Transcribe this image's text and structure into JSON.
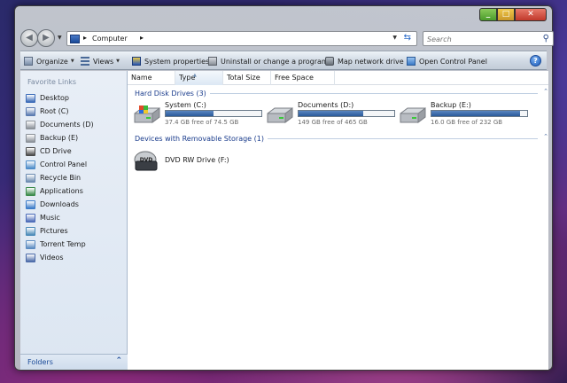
{
  "navigation": {
    "address_segments": [
      "Computer"
    ],
    "search_placeholder": "Search"
  },
  "toolbar": {
    "items": [
      {
        "label": "Organize",
        "dropdown": true
      },
      {
        "label": "Views",
        "dropdown": true
      },
      {
        "label": "System properties",
        "dropdown": false
      },
      {
        "label": "Uninstall or change a program",
        "dropdown": false
      },
      {
        "label": "Map network drive",
        "dropdown": false
      },
      {
        "label": "Open Control Panel",
        "dropdown": false
      }
    ]
  },
  "sidebar": {
    "title": "Favorite Links",
    "items": [
      {
        "label": "Desktop",
        "icon": "desktop-icon",
        "color": "#3a6ab8"
      },
      {
        "label": "Root (C)",
        "icon": "drive-icon",
        "color": "#5a7ab0"
      },
      {
        "label": "Documents (D)",
        "icon": "drive-icon",
        "color": "#8a9098"
      },
      {
        "label": "Backup (E)",
        "icon": "drive-icon",
        "color": "#8a9098"
      },
      {
        "label": "CD Drive",
        "icon": "disc-icon",
        "color": "#4a4a4a"
      },
      {
        "label": "Control Panel",
        "icon": "control-panel-icon",
        "color": "#4a8ac8"
      },
      {
        "label": "Recycle Bin",
        "icon": "recycle-bin-icon",
        "color": "#6a8ab0"
      },
      {
        "label": "Applications",
        "icon": "applications-icon",
        "color": "#3a8a4a"
      },
      {
        "label": "Downloads",
        "icon": "downloads-icon",
        "color": "#3a7ac8"
      },
      {
        "label": "Music",
        "icon": "music-icon",
        "color": "#4a6ab8"
      },
      {
        "label": "Pictures",
        "icon": "pictures-icon",
        "color": "#4a8ab8"
      },
      {
        "label": "Torrent Temp",
        "icon": "folder-icon",
        "color": "#5a8ac0"
      },
      {
        "label": "Videos",
        "icon": "videos-icon",
        "color": "#4a6aa8"
      }
    ],
    "folders_label": "Folders"
  },
  "columns": [
    "Name",
    "Type",
    "Total Size",
    "Free Space"
  ],
  "groups": {
    "hard_disks": {
      "title": "Hard Disk Drives (3)",
      "drives": [
        {
          "name": "System (C:)",
          "free_text": "37.4 GB free of 74.5 GB",
          "used_fraction": 0.5
        },
        {
          "name": "Documents (D:)",
          "free_text": "149 GB free of 465 GB",
          "used_fraction": 0.68
        },
        {
          "name": "Backup (E:)",
          "free_text": "16.0 GB free of 232 GB",
          "used_fraction": 0.93
        }
      ]
    },
    "removable": {
      "title": "Devices with Removable Storage (1)",
      "drives": [
        {
          "name": "DVD RW Drive (F:)",
          "icon_text": "DVD"
        }
      ]
    }
  },
  "colors": {
    "accent": "#1a3c8c",
    "bar_fill": "#2a5a9a"
  }
}
